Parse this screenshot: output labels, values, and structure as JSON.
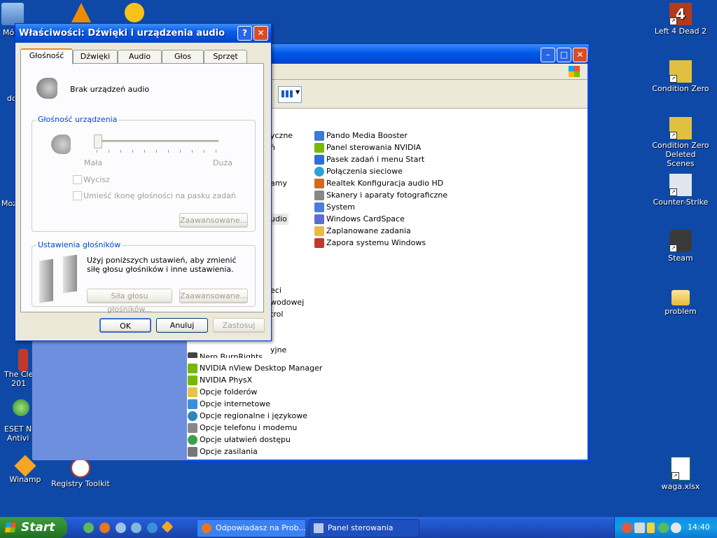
{
  "desktop": {
    "icons_left": [
      {
        "label": "Mó",
        "icon": "my-computer-icon"
      },
      {
        "label": "",
        "icon": "vlc-icon"
      },
      {
        "label": "",
        "icon": "smiley-icon"
      },
      {
        "label": "do",
        "icon": "document-icon"
      },
      {
        "label": "Moz",
        "icon": "mozilla-icon"
      },
      {
        "label": "The Cle\n201",
        "icon": "cleaner-icon"
      },
      {
        "label": "ESET N\nAntivi",
        "icon": "eset-icon"
      },
      {
        "label": "Winamp",
        "icon": "winamp-icon"
      },
      {
        "label": "Registry Toolkit",
        "icon": "registry-toolkit-icon"
      }
    ],
    "icons_right": [
      {
        "label": "Left 4 Dead 2",
        "icon": "left4dead-icon"
      },
      {
        "label": "Condition Zero",
        "icon": "condition-zero-icon"
      },
      {
        "label": "Condition Zero Deleted Scenes",
        "icon": "condition-zero-ds-icon"
      },
      {
        "label": "Counter-Strike",
        "icon": "counter-strike-icon"
      },
      {
        "label": "Steam",
        "icon": "steam-icon"
      },
      {
        "label": "problem",
        "icon": "folder-icon"
      },
      {
        "label": "waga.xlsx",
        "icon": "excel-icon"
      }
    ]
  },
  "control_panel": {
    "partial_left": [
      "yczne",
      "ń",
      "amy",
      "udio",
      "eci",
      "wodowej",
      "trol",
      "yjne"
    ],
    "items_right": [
      {
        "label": "Pando Media Booster",
        "icon": "pando-icon",
        "color": "#3a7bd5"
      },
      {
        "label": "Panel sterowania NVIDIA",
        "icon": "nvidia-icon",
        "color": "#76b900"
      },
      {
        "label": "Pasek zadań i menu Start",
        "icon": "taskbar-icon",
        "color": "#2f6fd0"
      },
      {
        "label": "Połączenia sieciowe",
        "icon": "network-icon",
        "color": "#2aa2d8"
      },
      {
        "label": "Realtek Konfiguracja audio HD",
        "icon": "realtek-icon",
        "color": "#d2691e"
      },
      {
        "label": "Skanery i aparaty fotograficzne",
        "icon": "scanner-icon",
        "color": "#888888"
      },
      {
        "label": "System",
        "icon": "system-icon",
        "color": "#4a7fd8"
      },
      {
        "label": "Windows CardSpace",
        "icon": "cardspace-icon",
        "color": "#5b6fcf"
      },
      {
        "label": "Zaplanowane zadania",
        "icon": "scheduled-tasks-icon",
        "color": "#e8b84a"
      },
      {
        "label": "Zapora systemu Windows",
        "icon": "firewall-icon",
        "color": "#c0392b"
      }
    ],
    "items_bottom": [
      {
        "label": "Nero BurnRights",
        "icon": "nero-icon",
        "color": "#444444"
      },
      {
        "label": "NVIDIA nView Desktop Manager",
        "icon": "nvidia-icon",
        "color": "#76b900"
      },
      {
        "label": "NVIDIA PhysX",
        "icon": "physx-icon",
        "color": "#76b900"
      },
      {
        "label": "Opcje folderów",
        "icon": "folder-options-icon",
        "color": "#e8c24a"
      },
      {
        "label": "Opcje internetowe",
        "icon": "internet-options-icon",
        "color": "#3a8fd8"
      },
      {
        "label": "Opcje regionalne i językowe",
        "icon": "regional-icon",
        "color": "#2e86c1"
      },
      {
        "label": "Opcje telefonu i modemu",
        "icon": "phone-icon",
        "color": "#888888"
      },
      {
        "label": "Opcje ułatwień dostępu",
        "icon": "accessibility-icon",
        "color": "#3aa34a"
      },
      {
        "label": "Opcje zasilania",
        "icon": "power-icon",
        "color": "#777777"
      }
    ]
  },
  "dialog": {
    "title": "Właściwości: Dźwięki i urządzenia audio",
    "help_label": "?",
    "close_label": "✕",
    "tabs": [
      "Głośność",
      "Dźwięki",
      "Audio",
      "Głos",
      "Sprzęt"
    ],
    "no_device": "Brak urządzeń audio",
    "volume_group": "Głośność urządzenia",
    "slider_min": "Mała",
    "slider_max": "Duża",
    "slider_level": 0,
    "mute": "Wycisz",
    "tray_icon": "Umieść ikonę głośności na pasku zadań",
    "advanced": "Zaawansowane...",
    "speakers_group": "Ustawienia głośników",
    "speakers_text": "Użyj poniższych ustawień, aby zmienić siłę głosu głośników i inne ustawienia.",
    "speaker_volume": "Siła głosu głośników...",
    "advanced2": "Zaawansowane...",
    "ok": "OK",
    "cancel": "Anuluj",
    "apply": "Zastosuj"
  },
  "taskbar": {
    "start_label": "Start",
    "tasks": [
      {
        "label": "Odpowiadasz na Prob...",
        "icon": "firefox-icon"
      },
      {
        "label": "Panel sterowania",
        "icon": "control-panel-icon"
      }
    ],
    "clock": "14:40"
  }
}
